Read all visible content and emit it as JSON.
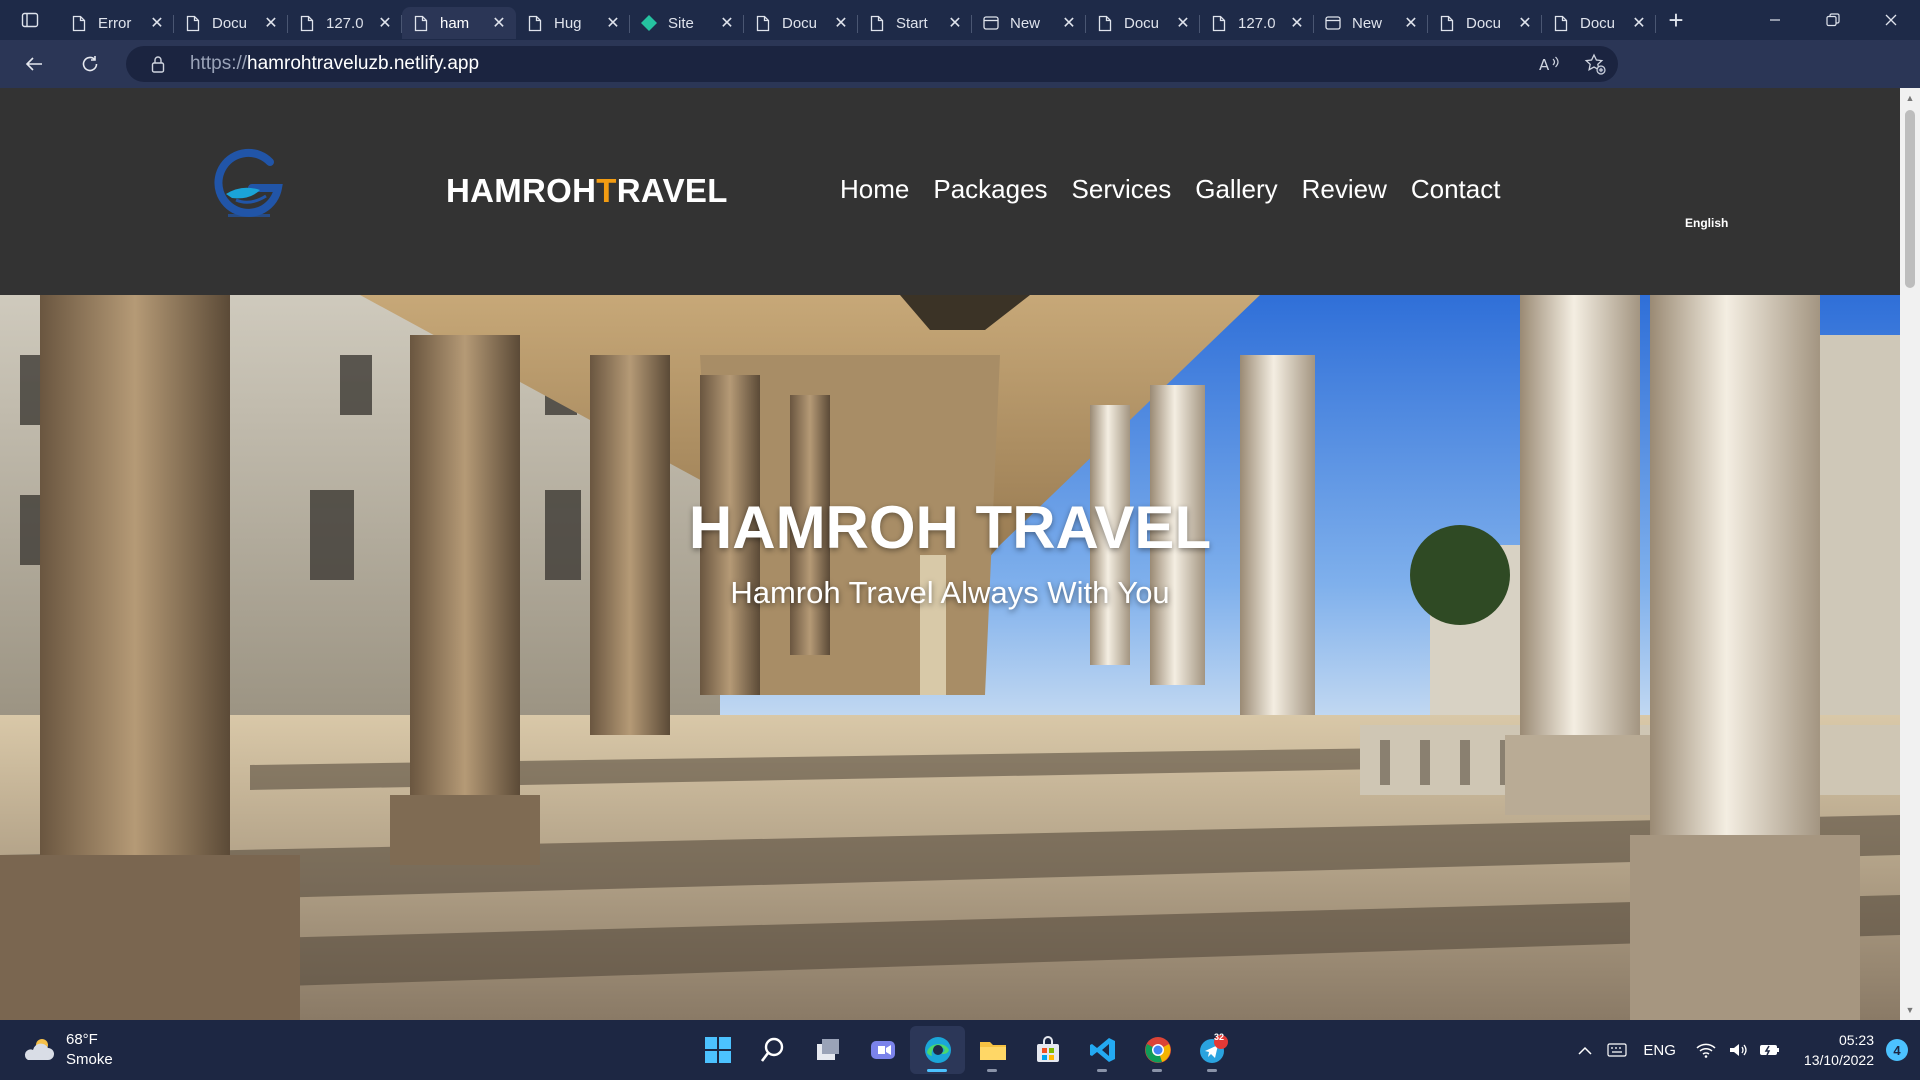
{
  "browser": {
    "tabs": [
      {
        "label": "Error",
        "icon": "page-icon",
        "active": false
      },
      {
        "label": "Docu",
        "icon": "page-icon",
        "active": false
      },
      {
        "label": "127.0",
        "icon": "page-icon",
        "active": false
      },
      {
        "label": "ham",
        "icon": "page-icon",
        "active": true
      },
      {
        "label": "Hug",
        "icon": "page-icon",
        "active": false
      },
      {
        "label": "Site",
        "icon": "netlify-icon",
        "active": false
      },
      {
        "label": "Docu",
        "icon": "page-icon",
        "active": false
      },
      {
        "label": "Start",
        "icon": "page-icon",
        "active": false
      },
      {
        "label": "New",
        "icon": "newtab-icon",
        "active": false
      },
      {
        "label": "Docu",
        "icon": "page-icon",
        "active": false
      },
      {
        "label": "127.0",
        "icon": "page-icon",
        "active": false
      },
      {
        "label": "New",
        "icon": "newtab-icon",
        "active": false
      },
      {
        "label": "Docu",
        "icon": "page-icon",
        "active": false
      },
      {
        "label": "Docu",
        "icon": "page-icon",
        "active": false
      }
    ],
    "url_prefix": "https://",
    "url_host": "hamrohtraveluzb.netlify.app"
  },
  "site": {
    "brand_main": "HAMROH",
    "brand_accent": "T",
    "brand_rest": "RAVEL",
    "accent_color": "#f39c12",
    "nav": [
      "Home",
      "Packages",
      "Services",
      "Gallery",
      "Review",
      "Contact"
    ],
    "language": "English",
    "hero_title": "HAMROH TRAVEL",
    "hero_subtitle": "Hamroh Travel Always With You"
  },
  "taskbar": {
    "weather_temp": "68°F",
    "weather_desc": "Smoke",
    "apps": [
      "windows-start-icon",
      "search-icon",
      "task-view-icon",
      "teams-chat-icon",
      "edge-icon",
      "file-explorer-icon",
      "store-icon",
      "vscode-icon",
      "chrome-icon",
      "telegram-icon"
    ],
    "telegram_badge": "32",
    "input_lang": "ENG",
    "time": "05:23",
    "date": "13/10/2022",
    "notifications": "4"
  }
}
